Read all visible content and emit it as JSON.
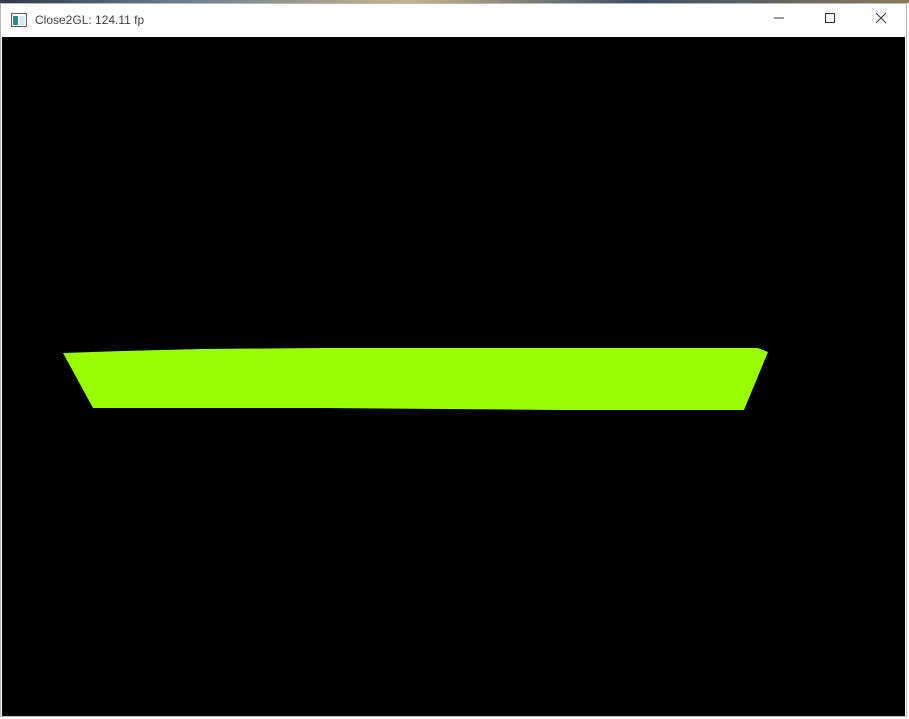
{
  "window": {
    "title": "Close2GL: 124.11 fp"
  },
  "controls": {
    "minimize_icon": "minimize-icon",
    "maximize_icon": "maximize-icon",
    "close_icon": "close-icon"
  },
  "scene": {
    "background_color": "#000000",
    "shape_color": "#99ff00"
  }
}
